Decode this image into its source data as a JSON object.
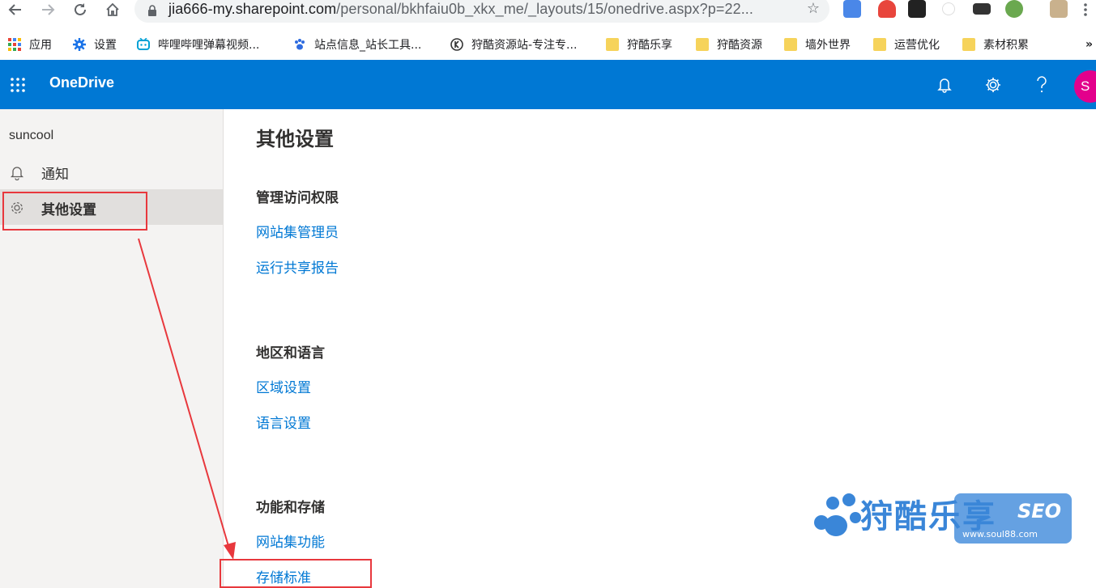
{
  "browser": {
    "url": {
      "host": "jia666-my.sharepoint.com",
      "path": "/personal/bkhfaiu0b_xkx_me/_layouts/15/onedrive.aspx?p=22..."
    },
    "bookmarks": [
      {
        "label": "应用",
        "icon": "apps-grid-icon"
      },
      {
        "label": "设置",
        "icon": "gear-icon"
      },
      {
        "label": "哔哩哔哩弹幕视频...",
        "icon": "bilibili-icon"
      },
      {
        "label": "站点信息_站长工具...",
        "icon": "paw-icon"
      },
      {
        "label": "狩酷资源站-专注专...",
        "icon": "k-circle-icon"
      },
      {
        "label": "狩酷乐享",
        "icon": "folder-icon"
      },
      {
        "label": "狩酷资源",
        "icon": "folder-icon"
      },
      {
        "label": "墙外世界",
        "icon": "folder-icon"
      },
      {
        "label": "运营优化",
        "icon": "folder-icon"
      },
      {
        "label": "素材积累",
        "icon": "folder-icon"
      }
    ],
    "more_bookmarks": "»"
  },
  "suitebar": {
    "brand": "OneDrive",
    "avatar_initial": "S",
    "accent": "#0078d4",
    "avatar_color": "#e3008c"
  },
  "leftnav": {
    "site_name": "suncool",
    "items": [
      {
        "label": "通知",
        "icon": "bell-icon",
        "selected": false
      },
      {
        "label": "其他设置",
        "icon": "gear-icon",
        "selected": true
      }
    ]
  },
  "main": {
    "title": "其他设置",
    "sections": [
      {
        "title": "管理访问权限",
        "links": [
          "网站集管理员",
          "运行共享报告"
        ]
      },
      {
        "title": "地区和语言",
        "links": [
          "区域设置",
          "语言设置"
        ]
      },
      {
        "title": "功能和存储",
        "links": [
          "网站集功能",
          "存储标准"
        ]
      }
    ]
  },
  "watermark": {
    "text": "狩酷乐享",
    "seo": "SEO",
    "site": "www.soul88.com"
  }
}
